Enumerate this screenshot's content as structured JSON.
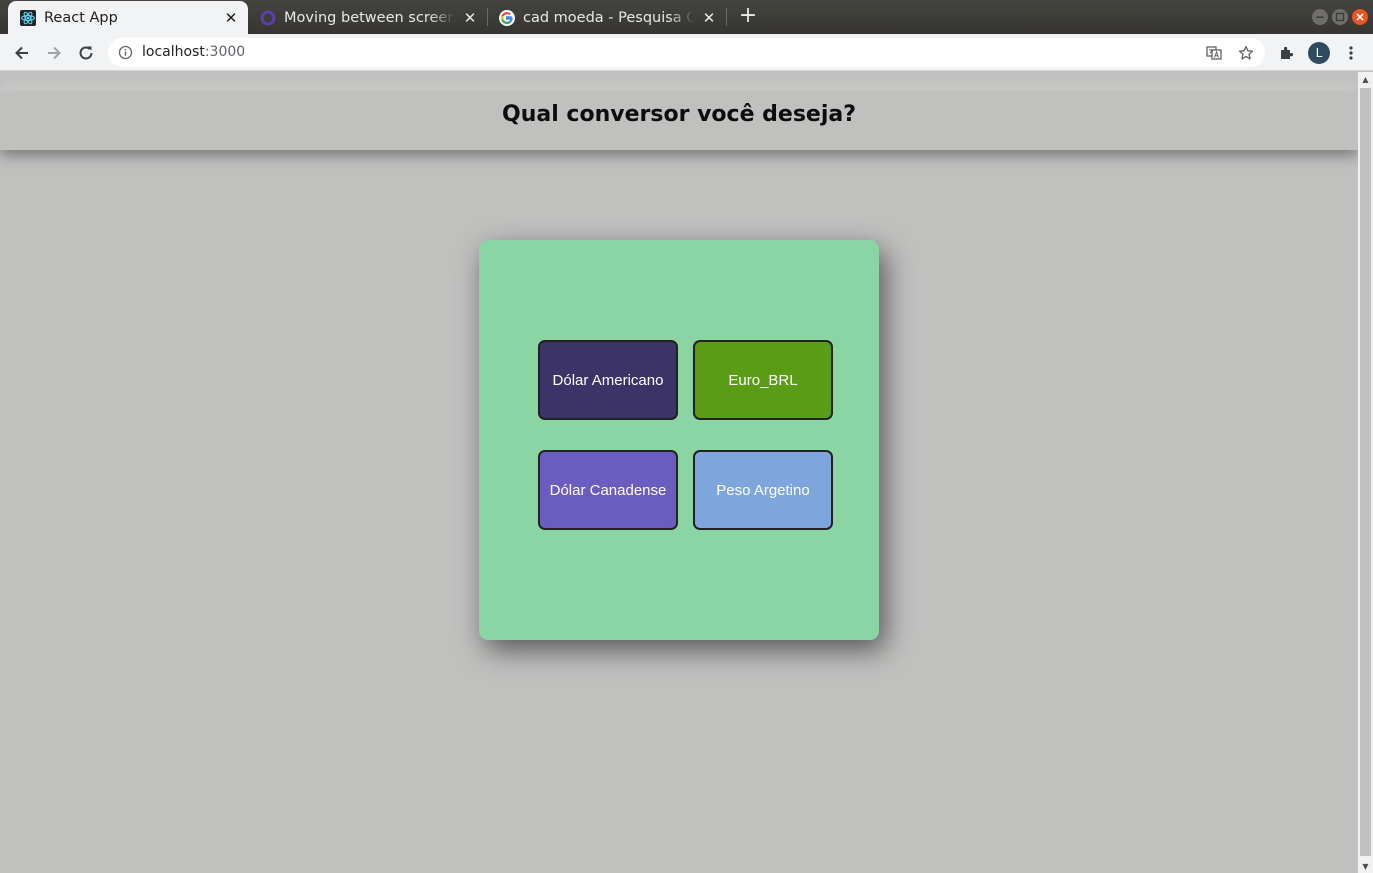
{
  "tabs": [
    {
      "title": "React App",
      "icon": "react-icon"
    },
    {
      "title": "Moving between screens",
      "icon": "ring-icon"
    },
    {
      "title": "cad moeda - Pesquisa Google",
      "icon": "google-icon"
    }
  ],
  "toolbar": {
    "url_host": "localhost",
    "url_port": ":3000"
  },
  "profile": {
    "initial": "L"
  },
  "page": {
    "title": "Qual conversor você deseja?",
    "buttons": [
      {
        "label": "Dólar Americano",
        "color": "#3c3468"
      },
      {
        "label": "Euro_BRL",
        "color": "#5a9c16"
      },
      {
        "label": "Dólar Canadense",
        "color": "#6b5dbf"
      },
      {
        "label": "Peso Argetino",
        "color": "#7ea5dc"
      }
    ],
    "card_color": "#8bd4a3",
    "background_color": "#c0c0bf"
  }
}
